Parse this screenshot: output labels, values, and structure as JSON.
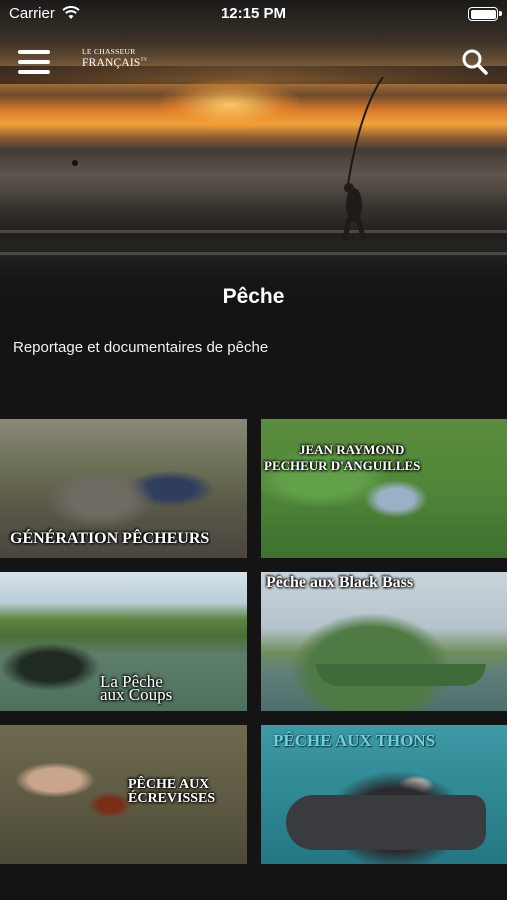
{
  "status_bar": {
    "carrier": "Carrier",
    "time": "12:15 PM",
    "battery_level": 1.0
  },
  "header": {
    "menu_icon": "hamburger-menu-icon",
    "logo": {
      "line1": "LE CHASSEUR",
      "line2": "FRANÇAIS",
      "suffix": "TV"
    },
    "search_icon": "search-icon"
  },
  "hero": {
    "title": "Pêche",
    "description": "Reportage et documentaires de pêche"
  },
  "videos": [
    {
      "caption": "GÉNÉRATION PÊCHEURS"
    },
    {
      "caption_line1": "JEAN RAYMOND",
      "caption_line2": "PECHEUR D'ANGUILLES"
    },
    {
      "caption_line1": "La Pêche",
      "caption_line2": "aux Coups"
    },
    {
      "caption": "Pêche aux Black Bass"
    },
    {
      "caption_line1": "PÊCHE AUX",
      "caption_line2": "ÉCREVISSES"
    },
    {
      "caption": "PÊCHE AUX THONS"
    }
  ]
}
